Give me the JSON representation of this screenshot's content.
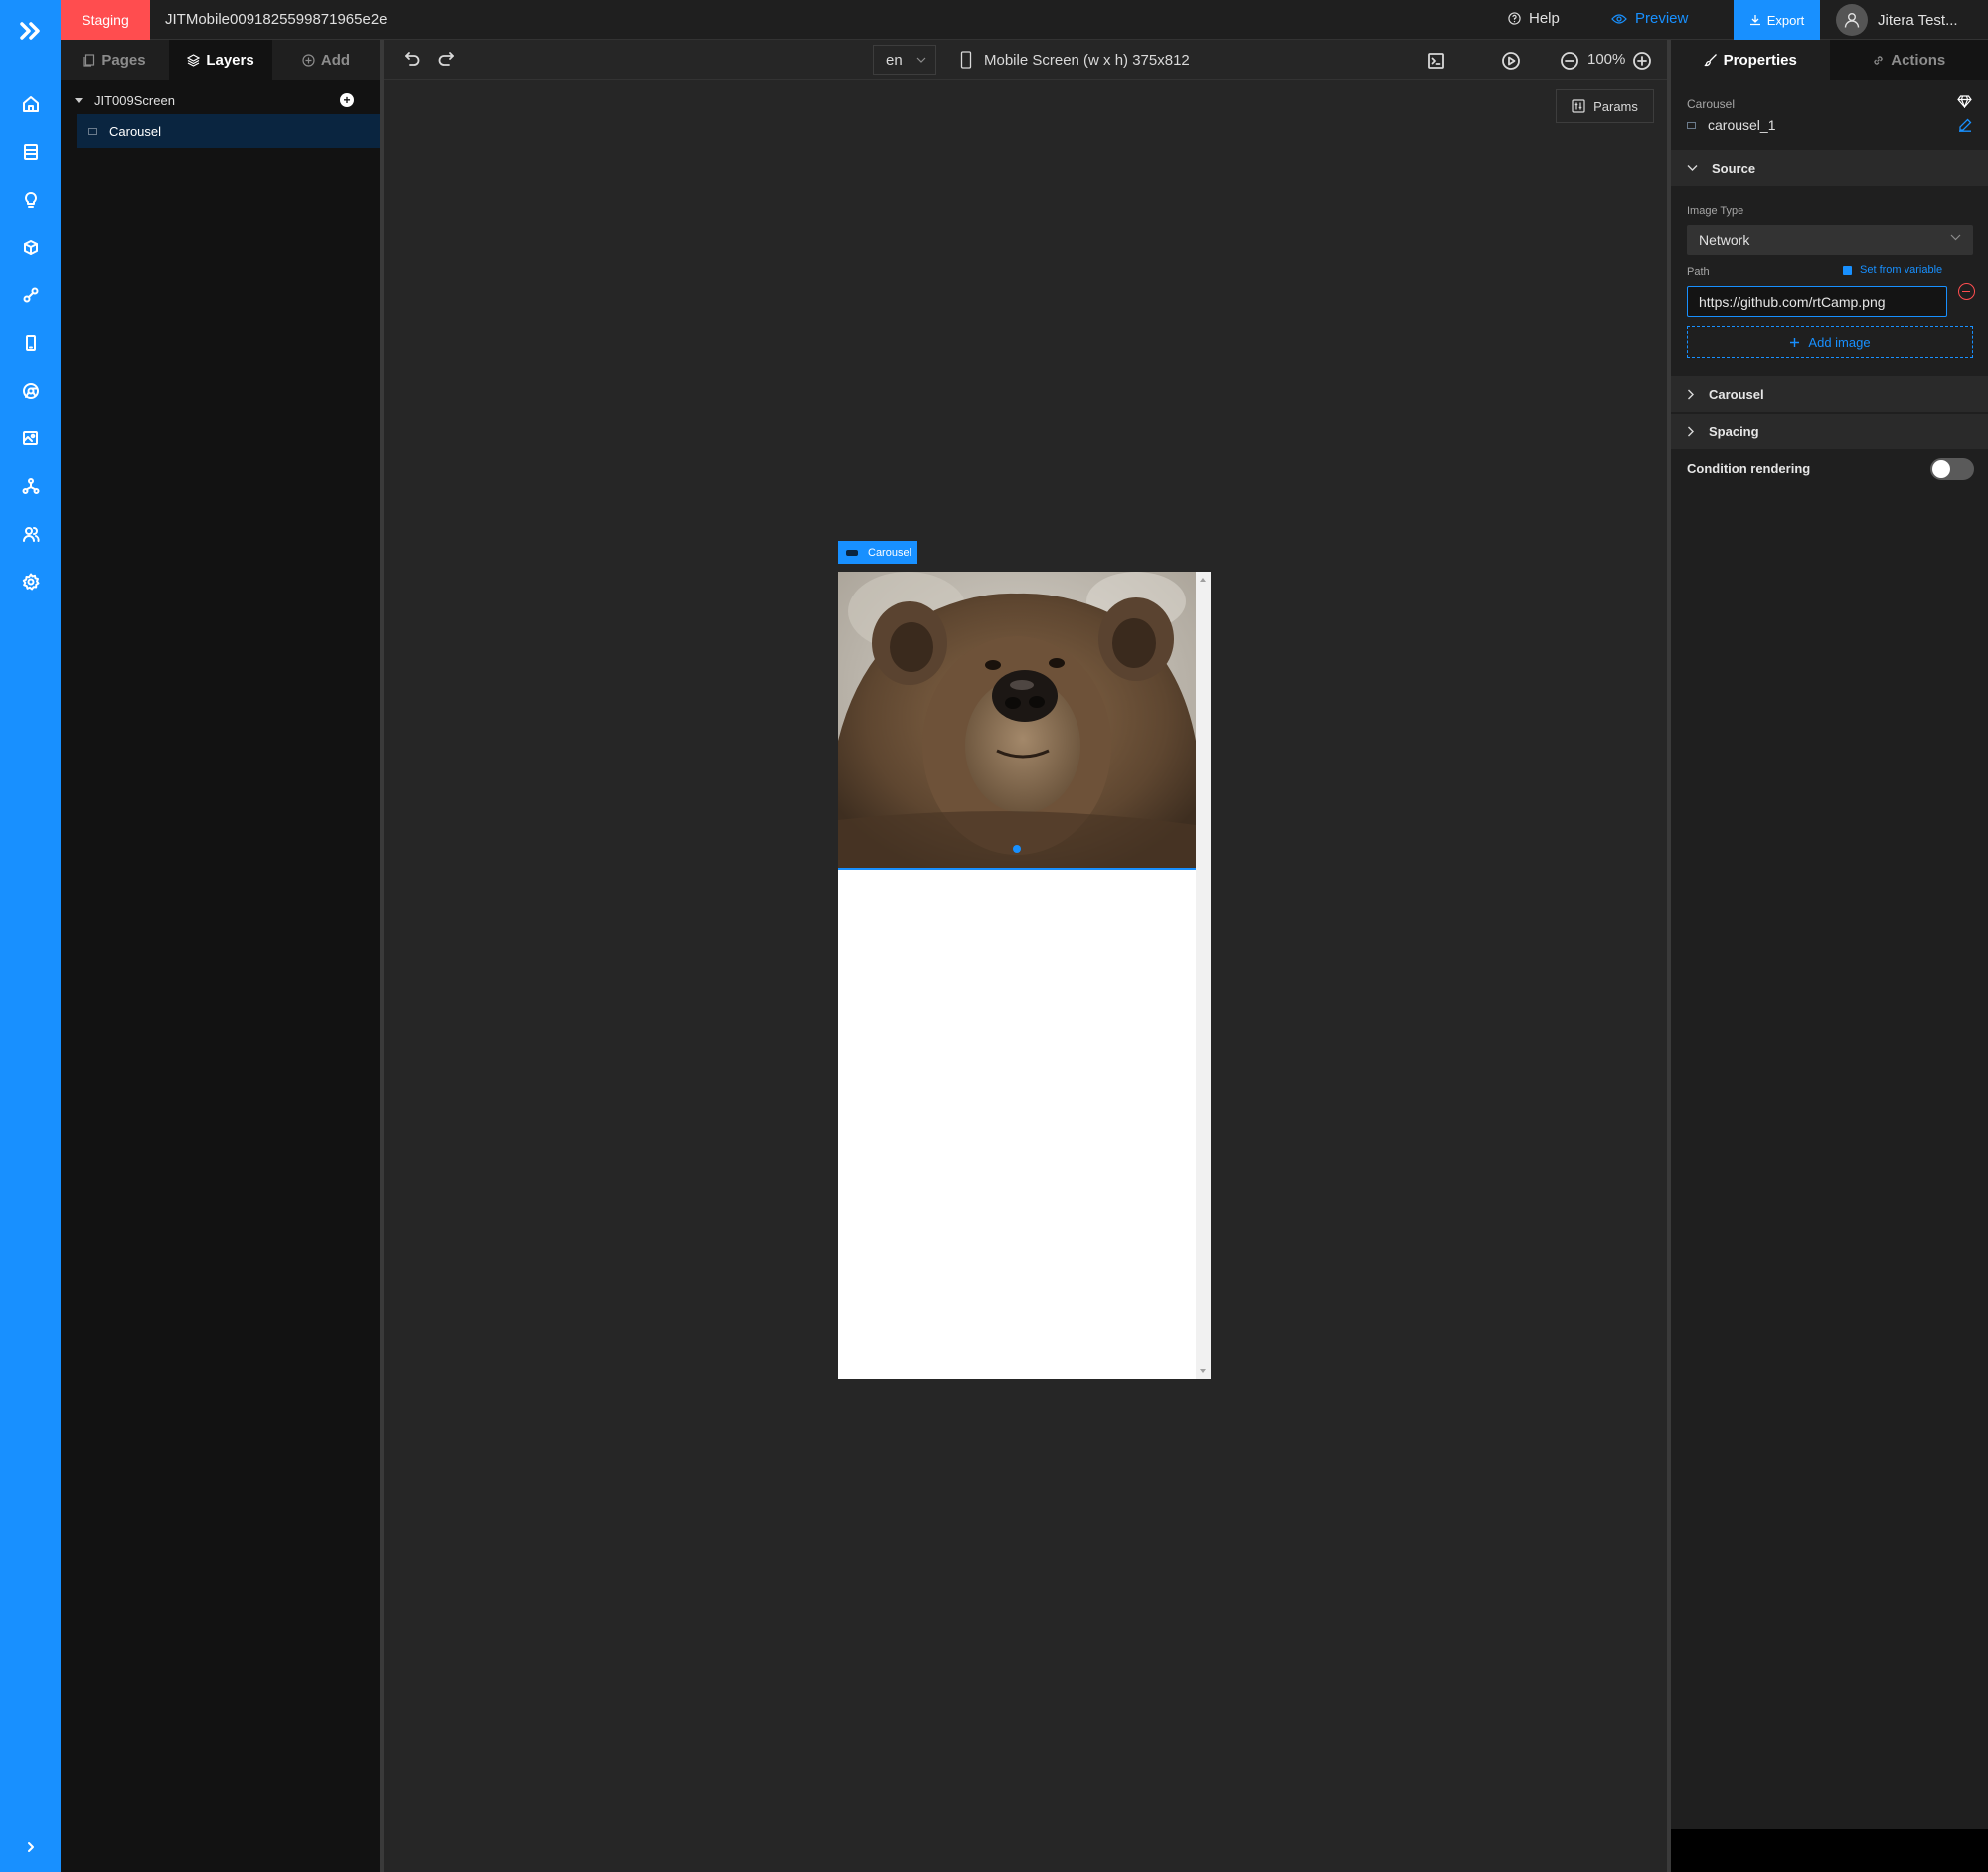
{
  "topbar": {
    "env_badge": "Staging",
    "project_name": "JITMobile0091825599871965e2e",
    "help_label": "Help",
    "preview_label": "Preview",
    "export_label": "Export",
    "user_name": "Jitera Test..."
  },
  "left_panel": {
    "tabs": [
      {
        "label": "Pages",
        "icon": "pages-icon"
      },
      {
        "label": "Layers",
        "icon": "layers-icon",
        "active": true
      },
      {
        "label": "Add",
        "icon": "plus-circle-icon"
      }
    ],
    "tree": {
      "root": "JIT009Screen",
      "items": [
        {
          "label": "Carousel",
          "selected": true
        }
      ]
    }
  },
  "rail": {
    "icons": [
      "home-icon",
      "database-icon",
      "bulb-icon",
      "cube-icon",
      "api-icon",
      "mobile-icon",
      "chrome-icon",
      "image-icon",
      "workflow-icon",
      "users-icon",
      "settings-icon",
      "expand-icon"
    ]
  },
  "canvas": {
    "language": "en",
    "screen_label": "Mobile Screen (w x h) 375x812",
    "zoom": "100%",
    "params_label": "Params",
    "component_tag": "Carousel",
    "carousel": {
      "active_index": 0,
      "slide_count": 1,
      "image": "brown bear photo"
    }
  },
  "right_panel": {
    "tabs": [
      {
        "label": "Properties",
        "active": true
      },
      {
        "label": "Actions"
      }
    ],
    "component_type": "Carousel",
    "component_id": "carousel_1",
    "sections": {
      "source": "Source",
      "carousel": "Carousel",
      "spacing": "Spacing"
    },
    "image_type_label": "Image Type",
    "image_type_value": "Network",
    "path_label": "Path",
    "set_from_variable": "Set from variable",
    "path_value": "https://github.com/rtCamp.png",
    "add_image": "Add image",
    "condition_rendering": "Condition rendering",
    "condition_enabled": false
  },
  "colors": {
    "accent": "#1890ff",
    "staging": "#ff4d4f",
    "background": "#262626"
  }
}
